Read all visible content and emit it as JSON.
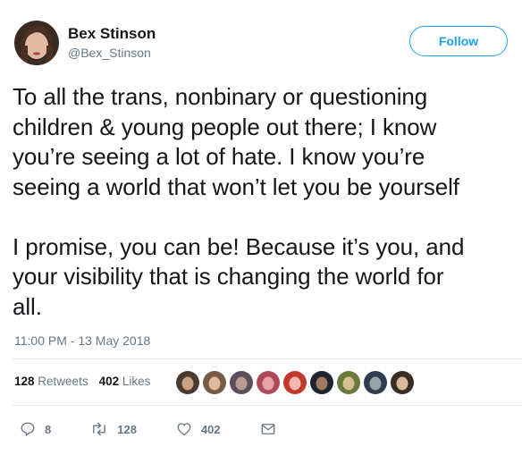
{
  "author": {
    "name": "Bex Stinson",
    "handle": "@Bex_Stinson"
  },
  "follow_label": "Follow",
  "tweet": {
    "text": "To all the trans, nonbinary or questioning\nchildren & young people out there; I know\nyou’re seeing a lot of hate. I know you’re\nseeing a world that won’t let you be yourself\n\nI promise, you can be! Because it’s you, and\nyour visibility that is changing the world for\nall.",
    "timestamp": "11:00 PM - 13 May 2018"
  },
  "stats": {
    "retweets_count": "128",
    "retweets_label": "Retweets",
    "likes_count": "402",
    "likes_label": "Likes"
  },
  "liker_avatars": [
    {
      "bg": "#4a3b30",
      "face": "#c9a183"
    },
    {
      "bg": "#7a5a44",
      "face": "#e1bba0"
    },
    {
      "bg": "#5d4e5c",
      "face": "#b89a8f"
    },
    {
      "bg": "#b04a5a",
      "face": "#e8a3a8"
    },
    {
      "bg": "#c0392b",
      "face": "#f1b6b0"
    },
    {
      "bg": "#1e2430",
      "face": "#a07a60"
    },
    {
      "bg": "#6b7a3a",
      "face": "#d4c090"
    },
    {
      "bg": "#2c3e50",
      "face": "#95a5a6"
    },
    {
      "bg": "#3a2d25",
      "face": "#d9b99b"
    }
  ],
  "actions": {
    "replies": "8",
    "retweets": "128",
    "likes": "402"
  },
  "colors": {
    "accent": "#1da1f2",
    "text": "#14171a",
    "muted": "#657786",
    "divider": "#e6ecf0"
  }
}
